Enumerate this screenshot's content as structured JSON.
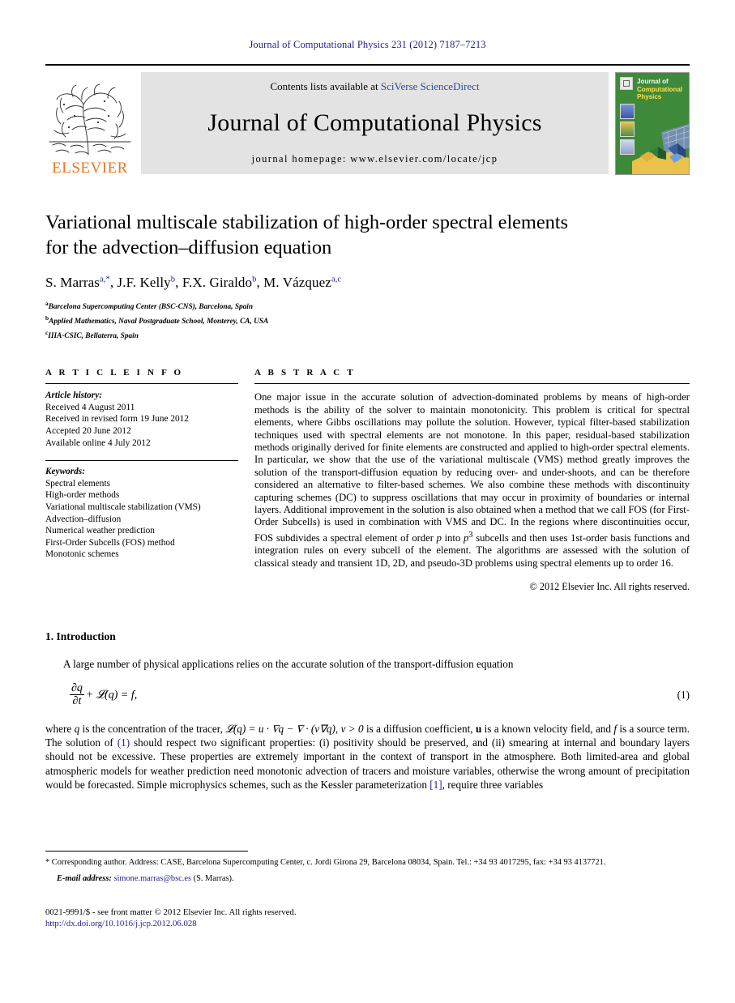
{
  "running_head": "Journal of Computational Physics 231 (2012) 7187–7213",
  "masthead": {
    "contents_prefix": "Contents lists available at ",
    "sciencedirect": "SciVerse ScienceDirect",
    "journal_title": "Journal of Computational Physics",
    "homepage": "journal homepage: www.elsevier.com/locate/jcp",
    "publisher_wordmark": "ELSEVIER",
    "cover": {
      "line1": "Journal of",
      "line2": "Computational",
      "line3": "Physics"
    }
  },
  "article": {
    "title_line1": "Variational multiscale stabilization of high-order spectral elements",
    "title_line2": "for the advection–diffusion equation",
    "authors": [
      {
        "name": "S. Marras",
        "sup": "a,*"
      },
      {
        "name": "J.F. Kelly",
        "sup": "b"
      },
      {
        "name": "F.X. Giraldo",
        "sup": "b"
      },
      {
        "name": "M. Vázquez",
        "sup": "a,c"
      }
    ],
    "affiliations": [
      {
        "mark": "a",
        "text": "Barcelona Supercomputing Center (BSC-CNS), Barcelona, Spain"
      },
      {
        "mark": "b",
        "text": "Applied Mathematics, Naval Postgraduate School, Monterey, CA, USA"
      },
      {
        "mark": "c",
        "text": "IIIA-CSIC, Bellaterra, Spain"
      }
    ]
  },
  "info": {
    "heading": "A R T I C L E   I N F O",
    "history_label": "Article history:",
    "history": [
      "Received 4 August 2011",
      "Received in revised form 19 June 2012",
      "Accepted 20 June 2012",
      "Available online 4 July 2012"
    ],
    "keywords_label": "Keywords:",
    "keywords": [
      "Spectral elements",
      "High-order methods",
      "Variational multiscale stabilization (VMS)",
      "Advection–diffusion",
      "Numerical weather prediction",
      "First-Order Subcells (FOS) method",
      "Monotonic schemes"
    ]
  },
  "abstract": {
    "heading": "A B S T R A C T",
    "text_part1": "One major issue in the accurate solution of advection-dominated problems by means of high-order methods is the ability of the solver to maintain monotonicity. This problem is critical for spectral elements, where Gibbs oscillations may pollute the solution. However, typical filter-based stabilization techniques used with spectral elements are not monotone. In this paper, residual-based stabilization methods originally derived for finite elements are constructed and applied to high-order spectral elements. In particular, we show that the use of the variational multiscale (VMS) method greatly improves the solution of the transport-diffusion equation by reducing over- and under-shoots, and can be therefore considered an alternative to filter-based schemes. We also combine these methods with discontinuity capturing schemes (DC) to suppress oscillations that may occur in proximity of boundaries or internal layers. Additional improvement in the solution is also obtained when a method that we call FOS (for First-Order Subcells) is used in combination with VMS and DC. In the regions where discontinuities occur, FOS subdivides a spectral element of order ",
    "math_p": "p",
    "text_part2": " into ",
    "math_p3": "p",
    "math_p3_sup": "3",
    "text_part3": " subcells and then uses 1st-order basis functions and integration rules on every subcell of the element. The algorithms are assessed with the solution of classical steady and transient 1D, 2D, and pseudo-3D problems using spectral elements up to order 16.",
    "copyright": "© 2012 Elsevier Inc. All rights reserved."
  },
  "body": {
    "section_heading": "1. Introduction",
    "para1": "A large number of physical applications relies on the accurate solution of the transport-diffusion equation",
    "equation": {
      "numerator": "∂q",
      "denominator": "∂t",
      "rest": "+ 𝓛(q) = f,",
      "number": "(1)"
    },
    "para2_a": "where ",
    "para2_q": "q",
    "para2_b": " is the concentration of the tracer, ",
    "para2_math": "𝓛(q) = u · ∇q − ∇ · (ν∇q)",
    "para2_c": ", ",
    "para2_math2": "ν > 0",
    "para2_d": " is a diffusion coefficient, ",
    "para2_u": "u",
    "para2_e": " is a known velocity field, and ",
    "para2_f": "f",
    "para2_g": " is a source term. The solution of ",
    "para2_ref1": "(1)",
    "para2_h": " should respect two significant properties: (i) positivity should be preserved, and (ii) smearing at internal and boundary layers should not be excessive. These properties are extremely important in the context of transport in the atmosphere. Both limited-area and global atmospheric models for weather prediction need monotonic advection of tracers and moisture variables, otherwise the wrong amount of precipitation would be forecasted. Simple microphysics schemes, such as the Kessler parameterization ",
    "para2_ref2": "[1]",
    "para2_i": ", require three variables"
  },
  "footnotes": {
    "corresponding": "* Corresponding author. Address: CASE, Barcelona Supercomputing Center, c. Jordi Girona 29, Barcelona 08034, Spain. Tel.: +34 93 4017295, fax: +34 93 4137721.",
    "email_label": "E-mail address:",
    "email": "simone.marras@bsc.es",
    "email_owner": "(S. Marras)."
  },
  "footer": {
    "issn_line": "0021-9991/$ - see front matter © 2012 Elsevier Inc. All rights reserved.",
    "doi": "http://dx.doi.org/10.1016/j.jcp.2012.06.028"
  },
  "colors": {
    "link_blue": "#1f1f8c",
    "sciencedirect_blue": "#2a4b9b",
    "elsevier_orange": "#E87722",
    "cover_green": "#3f8a3a",
    "masthead_gray": "#e3e3e3"
  }
}
